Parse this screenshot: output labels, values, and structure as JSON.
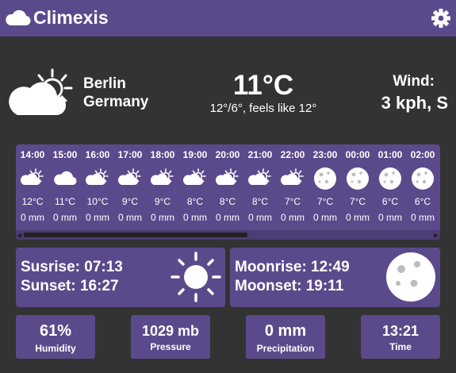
{
  "app": {
    "title": "Climexis"
  },
  "current": {
    "city": "Berlin",
    "country": "Germany",
    "temp": "11°C",
    "summary": "12°/6°, feels like 12°",
    "wind_label": "Wind:",
    "wind_value": "3 kph, S"
  },
  "hourly": [
    {
      "time": "14:00",
      "temp": "12°C",
      "rain": "0 mm",
      "icon": "partly-cloudy-day-icon"
    },
    {
      "time": "15:00",
      "temp": "11°C",
      "rain": "0 mm",
      "icon": "cloud-icon"
    },
    {
      "time": "16:00",
      "temp": "10°C",
      "rain": "0 mm",
      "icon": "partly-cloudy-day-icon"
    },
    {
      "time": "17:00",
      "temp": "9°C",
      "rain": "0 mm",
      "icon": "partly-cloudy-day-icon"
    },
    {
      "time": "18:00",
      "temp": "9°C",
      "rain": "0 mm",
      "icon": "partly-cloudy-day-icon"
    },
    {
      "time": "19:00",
      "temp": "8°C",
      "rain": "0 mm",
      "icon": "partly-cloudy-day-icon"
    },
    {
      "time": "20:00",
      "temp": "8°C",
      "rain": "0 mm",
      "icon": "partly-cloudy-day-icon"
    },
    {
      "time": "21:00",
      "temp": "8°C",
      "rain": "0 mm",
      "icon": "partly-cloudy-day-icon"
    },
    {
      "time": "22:00",
      "temp": "7°C",
      "rain": "0 mm",
      "icon": "partly-cloudy-day-icon"
    },
    {
      "time": "23:00",
      "temp": "7°C",
      "rain": "0 mm",
      "icon": "moon-icon"
    },
    {
      "time": "00:00",
      "temp": "7°C",
      "rain": "0 mm",
      "icon": "moon-icon"
    },
    {
      "time": "01:00",
      "temp": "6°C",
      "rain": "0 mm",
      "icon": "moon-icon"
    },
    {
      "time": "02:00",
      "temp": "6°C",
      "rain": "0 mm",
      "icon": "moon-icon"
    }
  ],
  "sun": {
    "sunrise": "Susrise: 07:13",
    "sunset": "Sunset: 16:27"
  },
  "moon": {
    "moonrise": "Moonrise: 12:49",
    "moonset": "Moonset: 19:11"
  },
  "stats": {
    "humidity": {
      "value": "61%",
      "label": "Humidity"
    },
    "pressure": {
      "value": "1029 mb",
      "label": "Pressure"
    },
    "precipitation": {
      "value": "0 mm",
      "label": "Precipitation"
    },
    "time": {
      "value": "13:21",
      "label": "Time"
    }
  },
  "colors": {
    "accent": "#5b4a8b",
    "background": "#333333"
  }
}
